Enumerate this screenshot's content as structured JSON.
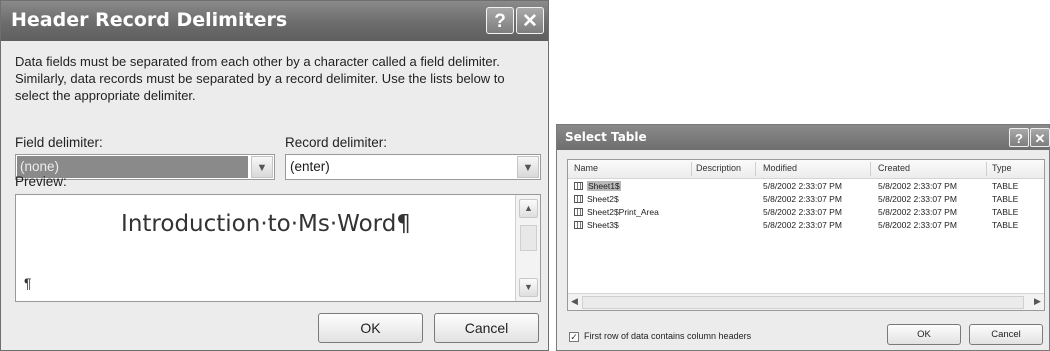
{
  "header_dialog": {
    "title": "Header Record Delimiters",
    "help_button": "?",
    "close_button": "✕",
    "description": "Data fields must be separated from each other by a character called a field delimiter. Similarly, data records must be separated by a record delimiter. Use the lists below to select the appropriate delimiter.",
    "field_delimiter_label": "Field delimiter:",
    "field_delimiter_value": "(none)",
    "record_delimiter_label": "Record delimiter:",
    "record_delimiter_value": "(enter)",
    "preview_label": "Preview:",
    "preview_text": "Introduction·to·Ms·Word¶",
    "preview_para_mark": "¶",
    "ok_label": "OK",
    "cancel_label": "Cancel"
  },
  "select_table_dialog": {
    "title": "Select Table",
    "help_button": "?",
    "close_button": "✕",
    "columns": [
      "Name",
      "Description",
      "Modified",
      "Created",
      "Type"
    ],
    "rows": [
      {
        "name": "Sheet1$",
        "description": "",
        "modified": "5/8/2002 2:33:07 PM",
        "created": "5/8/2002 2:33:07 PM",
        "type": "TABLE"
      },
      {
        "name": "Sheet2$",
        "description": "",
        "modified": "5/8/2002 2:33:07 PM",
        "created": "5/8/2002 2:33:07 PM",
        "type": "TABLE"
      },
      {
        "name": "Sheet2$Print_Area",
        "description": "",
        "modified": "5/8/2002 2:33:07 PM",
        "created": "5/8/2002 2:33:07 PM",
        "type": "TABLE"
      },
      {
        "name": "Sheet3$",
        "description": "",
        "modified": "5/8/2002 2:33:07 PM",
        "created": "5/8/2002 2:33:07 PM",
        "type": "TABLE"
      }
    ],
    "selected_row": 0,
    "first_row_headers_label": "First row of data contains column headers",
    "first_row_headers_checked": true,
    "ok_label": "OK",
    "cancel_label": "Cancel"
  }
}
